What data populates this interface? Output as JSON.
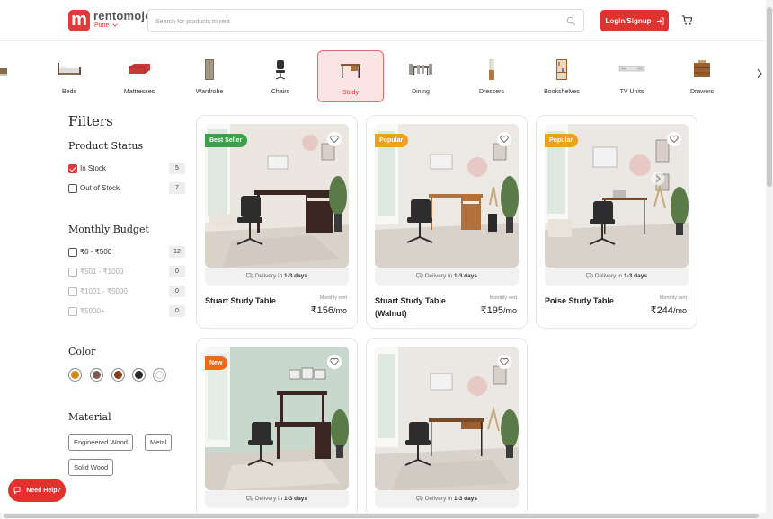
{
  "header": {
    "brand": "rentomojo",
    "city": "Pune",
    "search_placeholder": "Search for products to rent",
    "login_label": "Login/Signup"
  },
  "categories": [
    {
      "label": "Beds"
    },
    {
      "label": "Mattresses"
    },
    {
      "label": "Wardrobe"
    },
    {
      "label": "Chairs"
    },
    {
      "label": "Study",
      "active": true
    },
    {
      "label": "Dining"
    },
    {
      "label": "Dressers"
    },
    {
      "label": "Bookshelves"
    },
    {
      "label": "TV Units"
    },
    {
      "label": "Drawers"
    }
  ],
  "filters": {
    "title": "Filters",
    "product_status": {
      "title": "Product Status",
      "items": [
        {
          "label": "In Stock",
          "count": "5",
          "checked": true
        },
        {
          "label": "Out of Stock",
          "count": "7",
          "checked": false
        }
      ]
    },
    "monthly_budget": {
      "title": "Monthly Budget",
      "items": [
        {
          "label": "₹0 - ₹500",
          "count": "12"
        },
        {
          "label": "₹501 - ₹1000",
          "count": "0"
        },
        {
          "label": "₹1001 - ₹5000",
          "count": "0"
        },
        {
          "label": "₹5000+",
          "count": "0"
        }
      ]
    },
    "color": {
      "title": "Color",
      "swatches": [
        "#d08a14",
        "#7b5a52",
        "#8a3b12",
        "#2a2a2a",
        "#ffffff"
      ]
    },
    "material": {
      "title": "Material",
      "chips": [
        "Engineered Wood",
        "Metal",
        "Solid Wood"
      ]
    }
  },
  "products": [
    {
      "name": "Stuart Study Table",
      "badge": "Best Seller",
      "badge_color": "#3aa14a",
      "monthly_label": "Monthly rent",
      "price": "₹156",
      "per": "/mo",
      "delivery_prefix": "Delivery in",
      "delivery_days": "1-3 days"
    },
    {
      "name": "Stuart Study Table (Walnut)",
      "badge": "Popular",
      "badge_color": "#f0a020",
      "monthly_label": "Monthly rent",
      "price": "₹195",
      "per": "/mo",
      "delivery_prefix": "Delivery in",
      "delivery_days": "1-3 days"
    },
    {
      "name": "Poise Study Table",
      "badge": "Popular",
      "badge_color": "#f0a020",
      "monthly_label": "Monthly rent",
      "price": "₹244",
      "per": "/mo",
      "delivery_prefix": "Delivery in",
      "delivery_days": "1-3 days"
    },
    {
      "name": "",
      "badge": "New",
      "badge_color": "#f06a1a",
      "delivery_prefix": "Delivery in",
      "delivery_days": "1-3 days"
    },
    {
      "name": "",
      "badge": "",
      "delivery_prefix": "Delivery in",
      "delivery_days": "1-3 days"
    }
  ],
  "help": {
    "label": "Need Help?"
  },
  "colors": {
    "accent": "#e0322f",
    "active_bg": "#fde4e4"
  }
}
